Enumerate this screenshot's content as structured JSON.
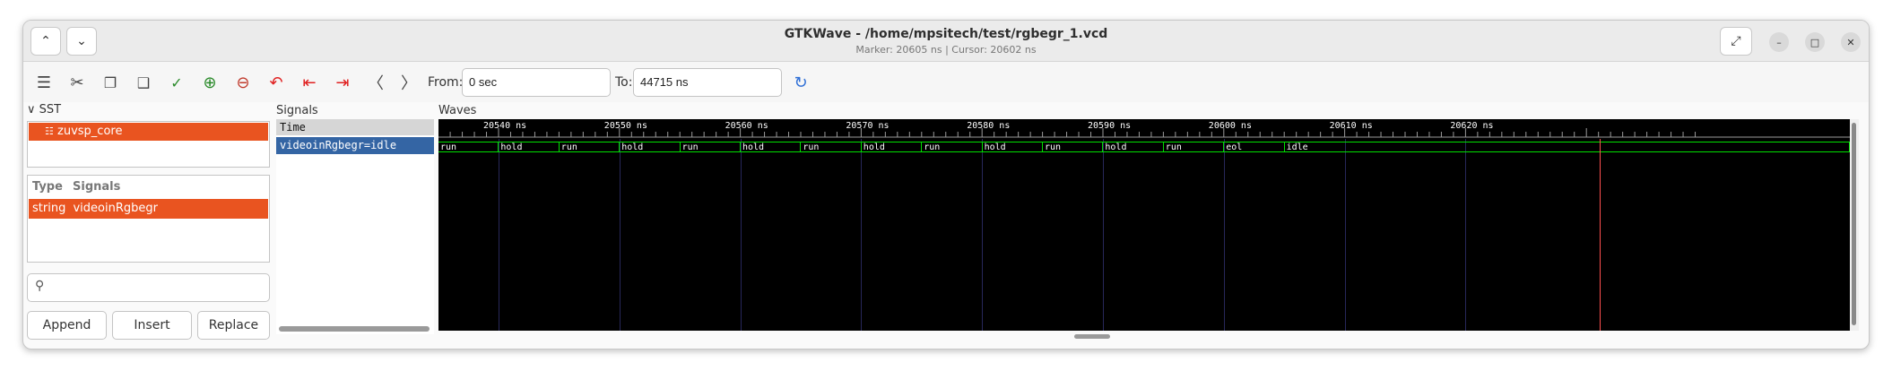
{
  "window": {
    "title": "GTKWave - /home/mpsitech/test/rgbegr_1.vcd",
    "status": "Marker: 20605 ns  |  Cursor: 20602 ns"
  },
  "toolbar": {
    "from_label": "From:",
    "from_value": "0 sec",
    "to_label": "To:",
    "to_value": "44715 ns"
  },
  "sst": {
    "header": "SST",
    "tree_item": "zuvsp_core",
    "col_type": "Type",
    "col_signals": "Signals",
    "row_type": "string",
    "row_signal": "videoinRgbegr",
    "search_placeholder": "",
    "buttons": [
      "Append",
      "Insert",
      "Replace"
    ]
  },
  "signals_panel": {
    "header": "Signals",
    "time_row": "Time",
    "signal_row": "videoinRgbegr=idle"
  },
  "waves_panel": {
    "header": "Waves",
    "ruler": [
      "20540 ns",
      "20550 ns",
      "20560 ns",
      "20570 ns",
      "20580 ns",
      "20590 ns",
      "20600 ns",
      "20610 ns",
      "20620 ns"
    ],
    "segments": [
      "run",
      "hold",
      "run",
      "hold",
      "run",
      "hold",
      "run",
      "hold",
      "run",
      "hold",
      "run",
      "hold",
      "run",
      "eol",
      "idle"
    ],
    "colors": {
      "trace": "#00e000",
      "background": "#000000",
      "cursor": "#ff5050",
      "selection": "#e95420",
      "signal_highlight": "#3465a4"
    }
  }
}
